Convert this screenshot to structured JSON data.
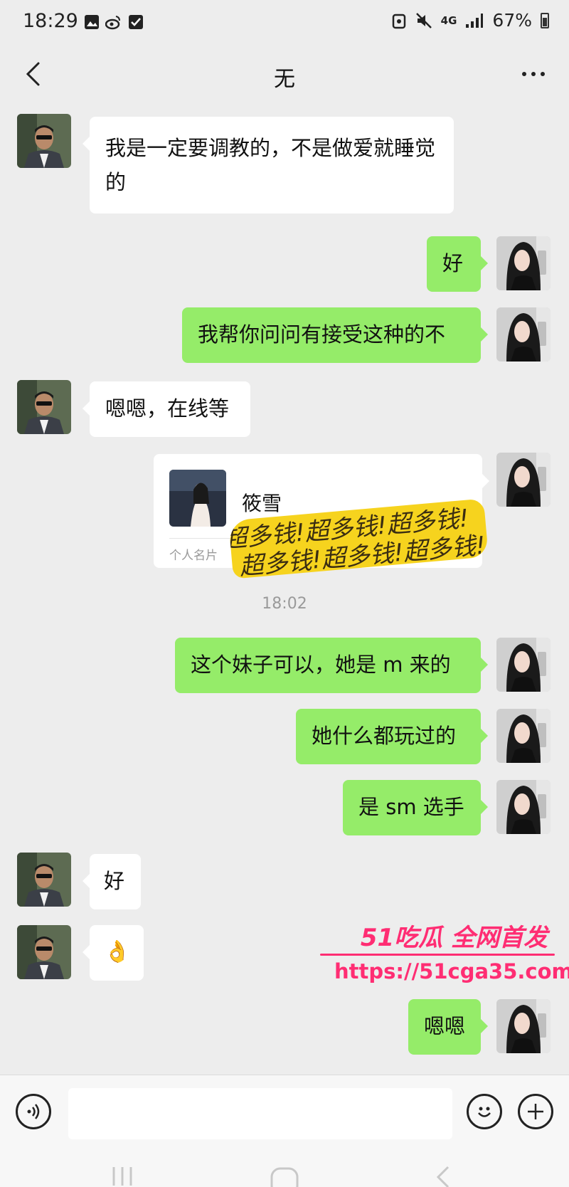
{
  "status_bar": {
    "time": "18:29",
    "network": "4G",
    "battery": "67%",
    "icons": [
      "gallery-icon",
      "weibo-icon",
      "checkbox-icon",
      "alarm-icon",
      "mute-icon",
      "network-icon",
      "signal-icon",
      "battery-icon"
    ]
  },
  "header": {
    "title": "无",
    "back_icon": "chevron-left-icon",
    "more_icon": "more-dots-icon"
  },
  "messages": [
    {
      "side": "in",
      "text": "我是一定要调教的，不是做爱就睡觉的"
    },
    {
      "side": "out",
      "text": "好"
    },
    {
      "side": "out",
      "text": "我帮你问问有接受这种的不"
    },
    {
      "side": "in",
      "text": "嗯嗯，在线等"
    },
    {
      "side": "out",
      "type": "contact_card",
      "name": "筱雪",
      "label": "个人名片",
      "sticker_text": "超多钱!超多钱!超多钱!"
    },
    {
      "type": "timestamp",
      "text": "18:02"
    },
    {
      "side": "out",
      "text": "这个妹子可以，她是 m 来的"
    },
    {
      "side": "out",
      "text": "她什么都玩过的"
    },
    {
      "side": "out",
      "text": "是 sm 选手"
    },
    {
      "side": "in",
      "text": "好"
    },
    {
      "side": "in",
      "type": "emoji",
      "emoji": "👌"
    },
    {
      "side": "out",
      "text": "嗯嗯"
    }
  ],
  "watermark": {
    "title": "51吃瓜 全网首发",
    "url": "https://51cga35.com"
  },
  "input_bar": {
    "voice_icon": "voice-icon",
    "emoji_icon": "smiley-icon",
    "plus_icon": "plus-icon"
  },
  "system_nav": [
    "recents-icon",
    "home-icon",
    "back-icon"
  ],
  "colors": {
    "background": "#ededed",
    "outgoing_bubble": "#95ec69",
    "incoming_bubble": "#ffffff",
    "watermark": "#ff2d73",
    "sticker": "#f6d31e"
  }
}
